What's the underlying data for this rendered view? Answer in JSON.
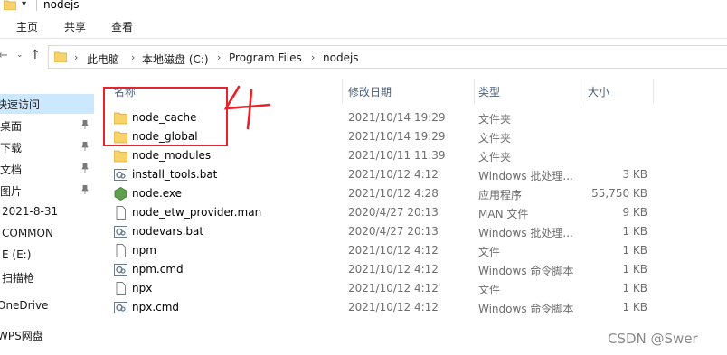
{
  "window": {
    "title": "nodejs"
  },
  "ribbon": {
    "tabs": [
      "主页",
      "共享",
      "查看"
    ]
  },
  "breadcrumb": [
    "此电脑",
    "本地磁盘 (C:)",
    "Program Files",
    "nodejs"
  ],
  "nav": {
    "items": [
      {
        "label": "快速访问",
        "selected": true,
        "pinned": false
      },
      {
        "label": "桌面",
        "pinned": true
      },
      {
        "label": "下载",
        "pinned": true
      },
      {
        "label": "文档",
        "pinned": true
      },
      {
        "label": "图片",
        "pinned": true
      },
      {
        "label": "2021-8-31",
        "pinned": false
      },
      {
        "label": "COMMON",
        "pinned": false
      },
      {
        "label": "E (E:)",
        "pinned": false
      },
      {
        "label": "扫描枪",
        "pinned": false
      },
      {
        "label": "OneDrive",
        "pinned": false
      },
      {
        "label": "WPS网盘",
        "pinned": false
      }
    ]
  },
  "columns": {
    "name": "名称",
    "date": "修改日期",
    "type": "类型",
    "size": "大小"
  },
  "files": [
    {
      "name": "node_cache",
      "date": "2021/10/14 19:29",
      "type": "文件夹",
      "size": "",
      "icon": "folder"
    },
    {
      "name": "node_global",
      "date": "2021/10/14 19:29",
      "type": "文件夹",
      "size": "",
      "icon": "folder"
    },
    {
      "name": "node_modules",
      "date": "2021/10/11 11:39",
      "type": "文件夹",
      "size": "",
      "icon": "folder"
    },
    {
      "name": "install_tools.bat",
      "date": "2021/10/12 4:12",
      "type": "Windows 批处理...",
      "size": "3 KB",
      "icon": "bat"
    },
    {
      "name": "node.exe",
      "date": "2021/10/12 4:28",
      "type": "应用程序",
      "size": "55,750 KB",
      "icon": "exe"
    },
    {
      "name": "node_etw_provider.man",
      "date": "2020/4/27 20:13",
      "type": "MAN 文件",
      "size": "9 KB",
      "icon": "file"
    },
    {
      "name": "nodevars.bat",
      "date": "2020/4/27 20:13",
      "type": "Windows 批处理...",
      "size": "1 KB",
      "icon": "bat"
    },
    {
      "name": "npm",
      "date": "2021/10/12 4:12",
      "type": "文件",
      "size": "1 KB",
      "icon": "file"
    },
    {
      "name": "npm.cmd",
      "date": "2021/10/12 4:12",
      "type": "Windows 命令脚本",
      "size": "1 KB",
      "icon": "bat"
    },
    {
      "name": "npx",
      "date": "2021/10/12 4:12",
      "type": "文件",
      "size": "1 KB",
      "icon": "file"
    },
    {
      "name": "npx.cmd",
      "date": "2021/10/12 4:12",
      "type": "Windows 命令脚本",
      "size": "1 KB",
      "icon": "bat"
    }
  ],
  "watermark": "CSDN @Swer",
  "colors": {
    "accent": "#1a6fd1",
    "folder": "#f8d26a",
    "annotation": "#e8222a",
    "selection": "#cce8ff"
  }
}
